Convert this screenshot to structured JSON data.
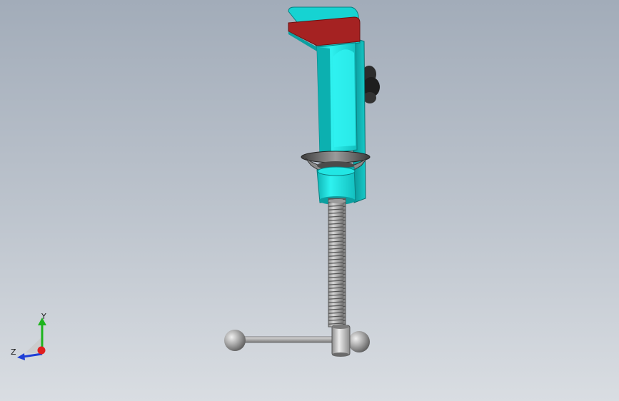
{
  "viewport": {
    "background_top": "#a2acb9",
    "background_bottom": "#d9dde2"
  },
  "model": {
    "body_color": "#17e0df",
    "top_face_color": "#a52222",
    "thread_color": "#a8a8a8",
    "handle_ball_color": "#b9b9b9",
    "knob_color": "#2c2c2c"
  },
  "triad": {
    "x_color": "#e01f1f",
    "y_color": "#1db41d",
    "z_color": "#1f3fd6",
    "label_y": "Y",
    "label_z": "Z"
  }
}
